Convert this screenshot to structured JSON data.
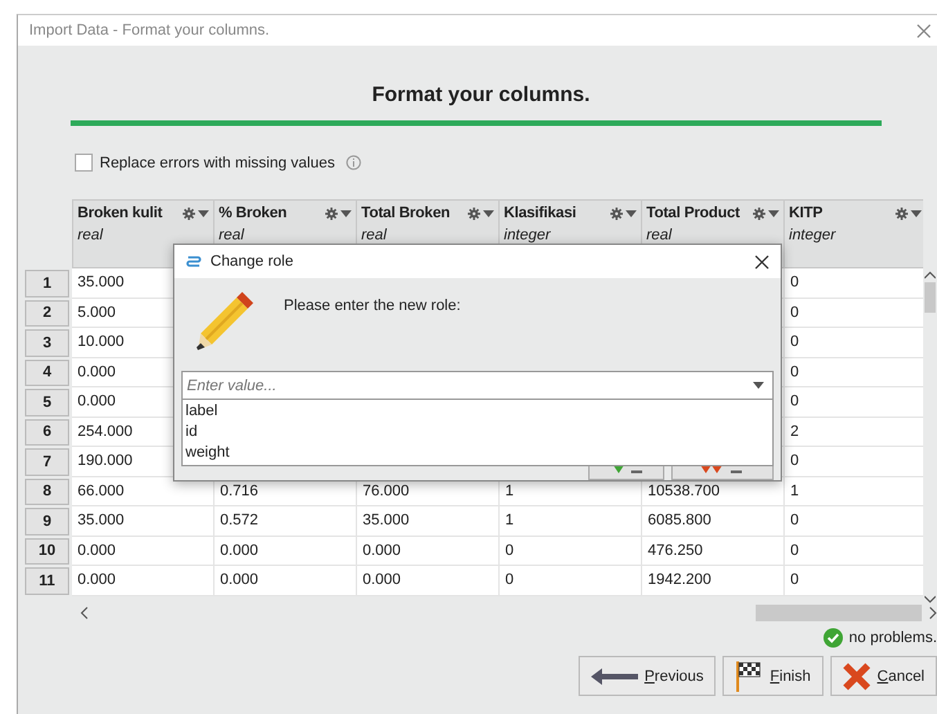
{
  "window": {
    "title": "Import Data - Format your columns."
  },
  "heading": "Format your columns.",
  "replace_errors": {
    "label": "Replace errors with missing values",
    "checked": false
  },
  "table": {
    "columns": [
      {
        "name": "Broken kulit",
        "type": "real"
      },
      {
        "name": "% Broken",
        "type": "real"
      },
      {
        "name": "Total Broken",
        "type": "real"
      },
      {
        "name": "Klasifikasi",
        "type": "integer"
      },
      {
        "name": "Total Product",
        "type": "real"
      },
      {
        "name": "KITP",
        "type": "integer"
      }
    ],
    "rows": [
      {
        "num": "1",
        "cells": [
          "35.000",
          null,
          null,
          null,
          null,
          "0"
        ]
      },
      {
        "num": "2",
        "cells": [
          "5.000",
          null,
          null,
          null,
          null,
          "0"
        ]
      },
      {
        "num": "3",
        "cells": [
          "10.000",
          null,
          null,
          null,
          null,
          "0"
        ]
      },
      {
        "num": "4",
        "cells": [
          "0.000",
          null,
          null,
          null,
          null,
          "0"
        ]
      },
      {
        "num": "5",
        "cells": [
          "0.000",
          null,
          null,
          null,
          null,
          "0"
        ]
      },
      {
        "num": "6",
        "cells": [
          "254.000",
          null,
          null,
          null,
          null,
          "2"
        ]
      },
      {
        "num": "7",
        "cells": [
          "190.000",
          null,
          null,
          null,
          null,
          "0"
        ]
      },
      {
        "num": "8",
        "cells": [
          "66.000",
          "0.716",
          "76.000",
          "1",
          "10538.700",
          "1"
        ]
      },
      {
        "num": "9",
        "cells": [
          "35.000",
          "0.572",
          "35.000",
          "1",
          "6085.800",
          "0"
        ]
      },
      {
        "num": "10",
        "cells": [
          "0.000",
          "0.000",
          "0.000",
          "0",
          "476.250",
          "0"
        ]
      },
      {
        "num": "11",
        "cells": [
          "0.000",
          "0.000",
          "0.000",
          "0",
          "1942.200",
          "0"
        ]
      }
    ]
  },
  "status": "no problems.",
  "buttons": [
    {
      "label": "Previous",
      "kind": "previous"
    },
    {
      "label": "Finish",
      "kind": "finish"
    },
    {
      "label": "Cancel",
      "kind": "cancel"
    }
  ],
  "change_role": {
    "title": "Change role",
    "prompt": "Please enter the new role:",
    "placeholder": "Enter value...",
    "options": [
      "label",
      "id",
      "weight"
    ]
  }
}
